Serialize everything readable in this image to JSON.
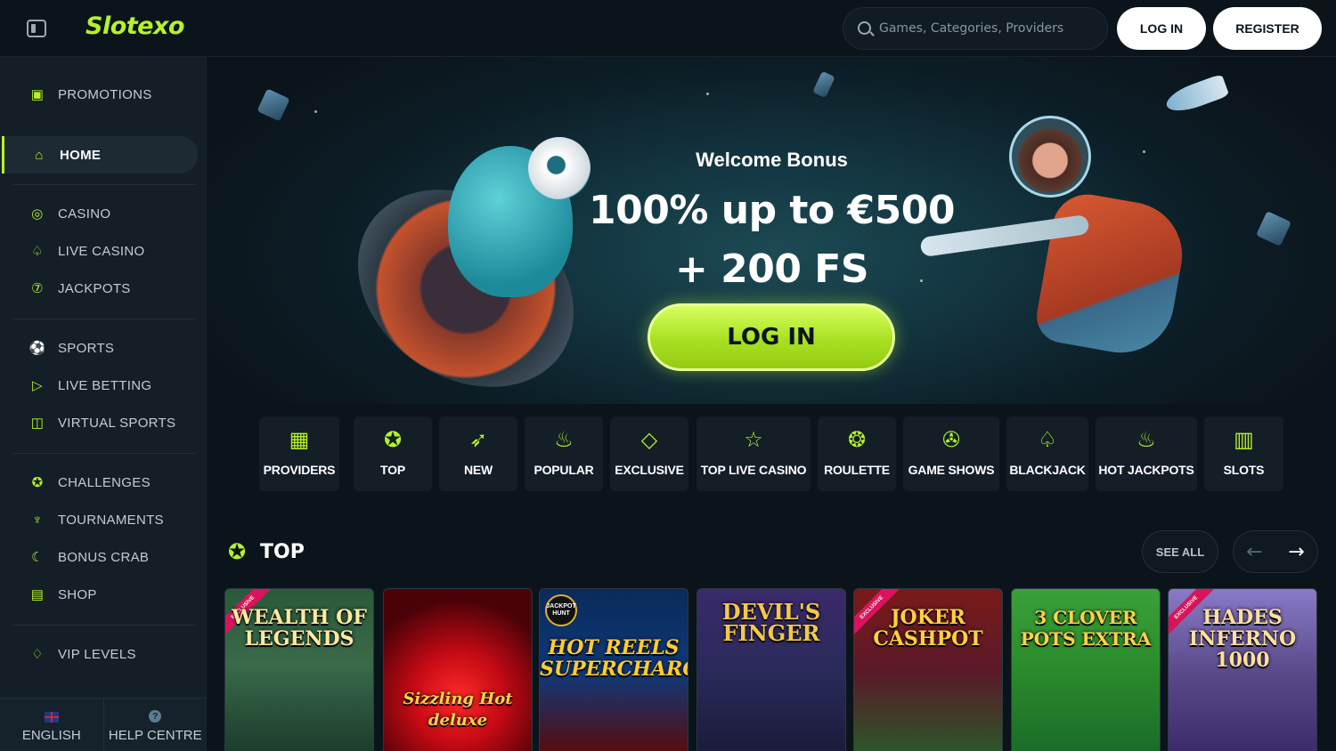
{
  "header": {
    "logo_text": "Slotexo",
    "search_placeholder": "Games, Categories, Providers",
    "login_label": "LOG IN",
    "register_label": "REGISTER",
    "accent_color": "#b5f22a"
  },
  "sidebar": {
    "items": [
      {
        "label": "PROMOTIONS",
        "icon": "gift-icon"
      },
      {
        "label": "HOME",
        "icon": "home-icon",
        "active": true
      },
      {
        "label": "CASINO",
        "icon": "chip-icon"
      },
      {
        "label": "LIVE CASINO",
        "icon": "spade-icon"
      },
      {
        "label": "JACKPOTS",
        "icon": "seven-icon"
      },
      {
        "label": "SPORTS",
        "icon": "ball-icon"
      },
      {
        "label": "LIVE BETTING",
        "icon": "play-icon"
      },
      {
        "label": "VIRTUAL SPORTS",
        "icon": "gamepad-icon"
      },
      {
        "label": "CHALLENGES",
        "icon": "medal-icon"
      },
      {
        "label": "TOURNAMENTS",
        "icon": "trophy-icon"
      },
      {
        "label": "BONUS CRAB",
        "icon": "crab-icon"
      },
      {
        "label": "SHOP",
        "icon": "shop-icon"
      },
      {
        "label": "VIP LEVELS",
        "icon": "diamond-icon"
      }
    ],
    "footer": {
      "language_label": "ENGLISH",
      "help_label": "HELP CENTRE",
      "help_dot": "?"
    }
  },
  "hero": {
    "subtitle": "Welcome Bonus",
    "title_line1": "100% up to €500",
    "title_line2": "+ 200 FS",
    "cta_label": "LOG IN"
  },
  "categories": [
    {
      "label": "PROVIDERS",
      "icon": "grid-icon"
    },
    {
      "label": "TOP",
      "icon": "medal-icon"
    },
    {
      "label": "NEW",
      "icon": "rocket-icon"
    },
    {
      "label": "POPULAR",
      "icon": "flame-icon"
    },
    {
      "label": "EXCLUSIVE",
      "icon": "diamond-icon"
    },
    {
      "label": "TOP LIVE CASINO",
      "icon": "star-icon"
    },
    {
      "label": "ROULETTE",
      "icon": "roulette-icon"
    },
    {
      "label": "GAME SHOWS",
      "icon": "wheel-icon"
    },
    {
      "label": "BLACKJACK",
      "icon": "spade-icon"
    },
    {
      "label": "HOT JACKPOTS",
      "icon": "fire-dragon-icon"
    },
    {
      "label": "SLOTS",
      "icon": "slot-machine-icon"
    }
  ],
  "top_section": {
    "title": "TOP",
    "see_all_label": "SEE ALL",
    "games": [
      {
        "title": "WEALTH OF LEGENDS",
        "badge": "EXCLUSIVE",
        "color": "#3a6a4a"
      },
      {
        "title": "Sizzling Hot deluxe",
        "badge": "",
        "color": "#8a0a14"
      },
      {
        "title": "HOT REELS SUPERCHARGED",
        "badge": "JACKPOT HUNT",
        "color": "#0a2a5a"
      },
      {
        "title": "DEVIL'S FINGER",
        "badge": "",
        "color": "#2a2a5a"
      },
      {
        "title": "JOKER CASHPOT",
        "badge": "EXCLUSIVE",
        "color": "#6a1a1a"
      },
      {
        "title": "3 CLOVER POTS EXTRA",
        "badge": "",
        "color": "#2a8a2a"
      },
      {
        "title": "HADES INFERNO 1000",
        "badge": "EXCLUSIVE",
        "color": "#5a4a8a"
      }
    ]
  }
}
